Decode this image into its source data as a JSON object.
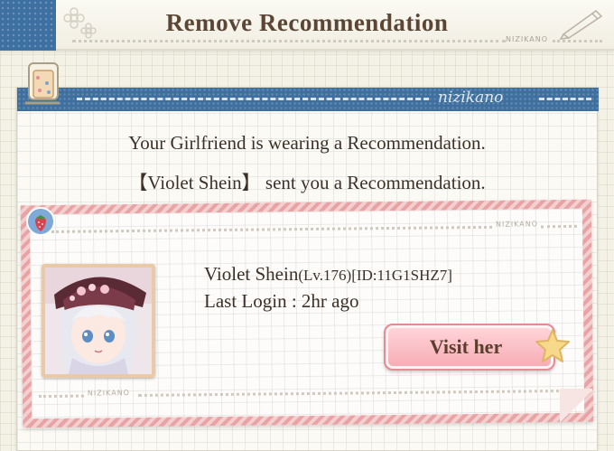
{
  "header": {
    "title": "Remove Recommendation",
    "brand": "NIZIKANO"
  },
  "panel": {
    "brand": "nizikano",
    "message_1": "Your Girlfriend is wearing a Recommendation.",
    "message_2": "【Violet Shein】 sent you a Recommendation."
  },
  "card": {
    "brand_top": "NIZIKANO",
    "brand_bottom": "NIZIKANO",
    "friend_name": "Violet Shein",
    "friend_level": "(Lv.176)",
    "friend_id": "[ID:11G1SHZ7]",
    "last_login": "Last Login : 2hr ago",
    "visit_label": "Visit her"
  },
  "colors": {
    "header_blue": "#3e6f9e",
    "card_pink": "#e8a3a5",
    "button_pink": "#f7aab3",
    "text_brown": "#5b4636"
  },
  "icons": [
    "flower-doodle-icon",
    "pencil-icon",
    "paper-clip-icon",
    "strawberry-icon",
    "star-icon"
  ]
}
